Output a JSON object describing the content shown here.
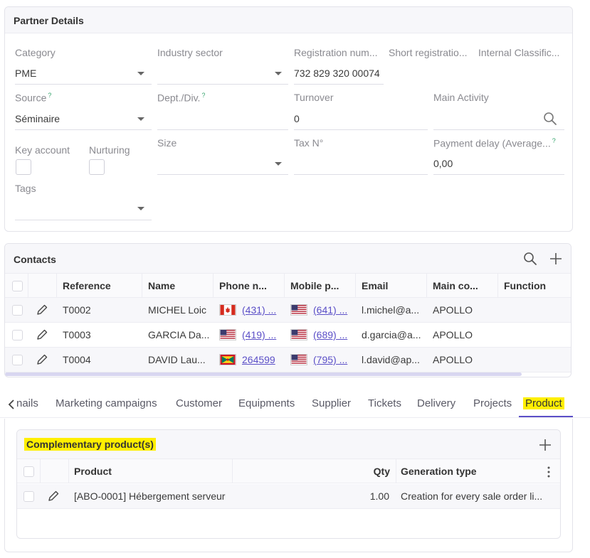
{
  "partner_details": {
    "title": "Partner Details",
    "category": {
      "label": "Category",
      "value": "PME"
    },
    "industry_sector": {
      "label": "Industry sector",
      "value": ""
    },
    "registration_number": {
      "label": "Registration num...",
      "value": "732 829 320 00074"
    },
    "short_registration": {
      "label": "Short registratio..."
    },
    "internal_classification": {
      "label": "Internal Classific..."
    },
    "source": {
      "label": "Source",
      "help": "?",
      "value": "Séminaire"
    },
    "dept_div": {
      "label": "Dept./Div.",
      "help": "?",
      "value": ""
    },
    "turnover": {
      "label": "Turnover",
      "value": "0"
    },
    "main_activity": {
      "label": "Main Activity",
      "value": ""
    },
    "key_account": {
      "label": "Key account"
    },
    "nurturing": {
      "label": "Nurturing"
    },
    "size": {
      "label": "Size",
      "value": ""
    },
    "tax_no": {
      "label": "Tax N°",
      "value": ""
    },
    "payment_delay": {
      "label": "Payment delay (Average...",
      "help": "?",
      "value": "0,00"
    },
    "tags": {
      "label": "Tags",
      "value": ""
    }
  },
  "contacts": {
    "title": "Contacts",
    "columns": [
      "Reference",
      "Name",
      "Phone n...",
      "Mobile p...",
      "Email",
      "Main co...",
      "Function"
    ],
    "rows": [
      {
        "reference": "T0002",
        "name": "MICHEL Loic",
        "phone_flag": "canada",
        "phone": "(431) ...",
        "mobile_flag": "usa",
        "mobile": "(641) ...",
        "email": "l.michel@a...",
        "main_company": "APOLLO",
        "function": ""
      },
      {
        "reference": "T0003",
        "name": "GARCIA Da...",
        "phone_flag": "usa",
        "phone": "(419) ...",
        "mobile_flag": "usa",
        "mobile": "(689) ...",
        "email": "d.garcia@a...",
        "main_company": "APOLLO",
        "function": ""
      },
      {
        "reference": "T0004",
        "name": "DAVID Lau...",
        "phone_flag": "grenada",
        "phone": "264599",
        "mobile_flag": "usa",
        "mobile": "(795) ...",
        "email": "l.david@ap...",
        "main_company": "APOLLO",
        "function": ""
      }
    ]
  },
  "tabs": {
    "prev_icon": "chevron-left-icon",
    "items": [
      {
        "label": "nails"
      },
      {
        "label": "Marketing campaigns"
      },
      {
        "label": "Customer"
      },
      {
        "label": "Equipments"
      },
      {
        "label": "Supplier"
      },
      {
        "label": "Tickets"
      },
      {
        "label": "Delivery"
      },
      {
        "label": "Projects"
      },
      {
        "label": "Product",
        "active": true
      }
    ]
  },
  "complementary_products": {
    "title": "Complementary product(s)",
    "columns": {
      "product": "Product",
      "qty": "Qty",
      "generation_type": "Generation type"
    },
    "rows": [
      {
        "product": "[ABO-0001] Hébergement serveur",
        "qty": "1.00",
        "generation_type": "Creation for every sale order li..."
      }
    ]
  },
  "colors": {
    "accent": "#5b4fc7",
    "highlight": "#ffef00",
    "help": "#33a36b"
  }
}
